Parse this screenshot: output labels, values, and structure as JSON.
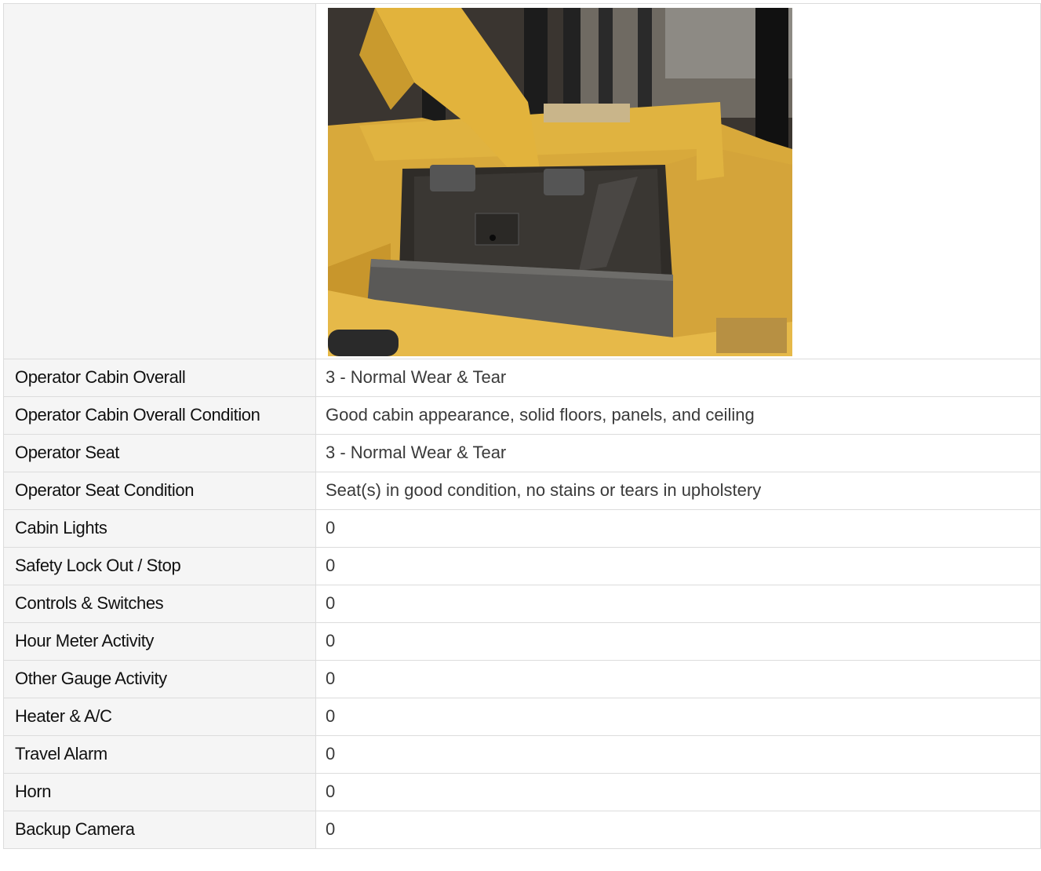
{
  "photo": {
    "alt_icon": "forklift-operator-pedal-photo"
  },
  "rows": [
    {
      "label": "Operator Cabin Overall",
      "value": "3 - Normal Wear & Tear"
    },
    {
      "label": "Operator Cabin Overall Condition",
      "value": "Good cabin appearance, solid floors, panels, and ceiling"
    },
    {
      "label": "Operator Seat",
      "value": "3 - Normal Wear & Tear"
    },
    {
      "label": "Operator Seat Condition",
      "value": "Seat(s) in good condition, no stains or tears in upholstery"
    },
    {
      "label": "Cabin Lights",
      "value": "0"
    },
    {
      "label": "Safety Lock Out / Stop",
      "value": "0"
    },
    {
      "label": "Controls & Switches",
      "value": "0"
    },
    {
      "label": "Hour Meter Activity",
      "value": "0"
    },
    {
      "label": "Other Gauge Activity",
      "value": "0"
    },
    {
      "label": "Heater & A/C",
      "value": "0"
    },
    {
      "label": "Travel Alarm",
      "value": "0"
    },
    {
      "label": "Horn",
      "value": "0"
    },
    {
      "label": "Backup Camera",
      "value": "0"
    }
  ]
}
